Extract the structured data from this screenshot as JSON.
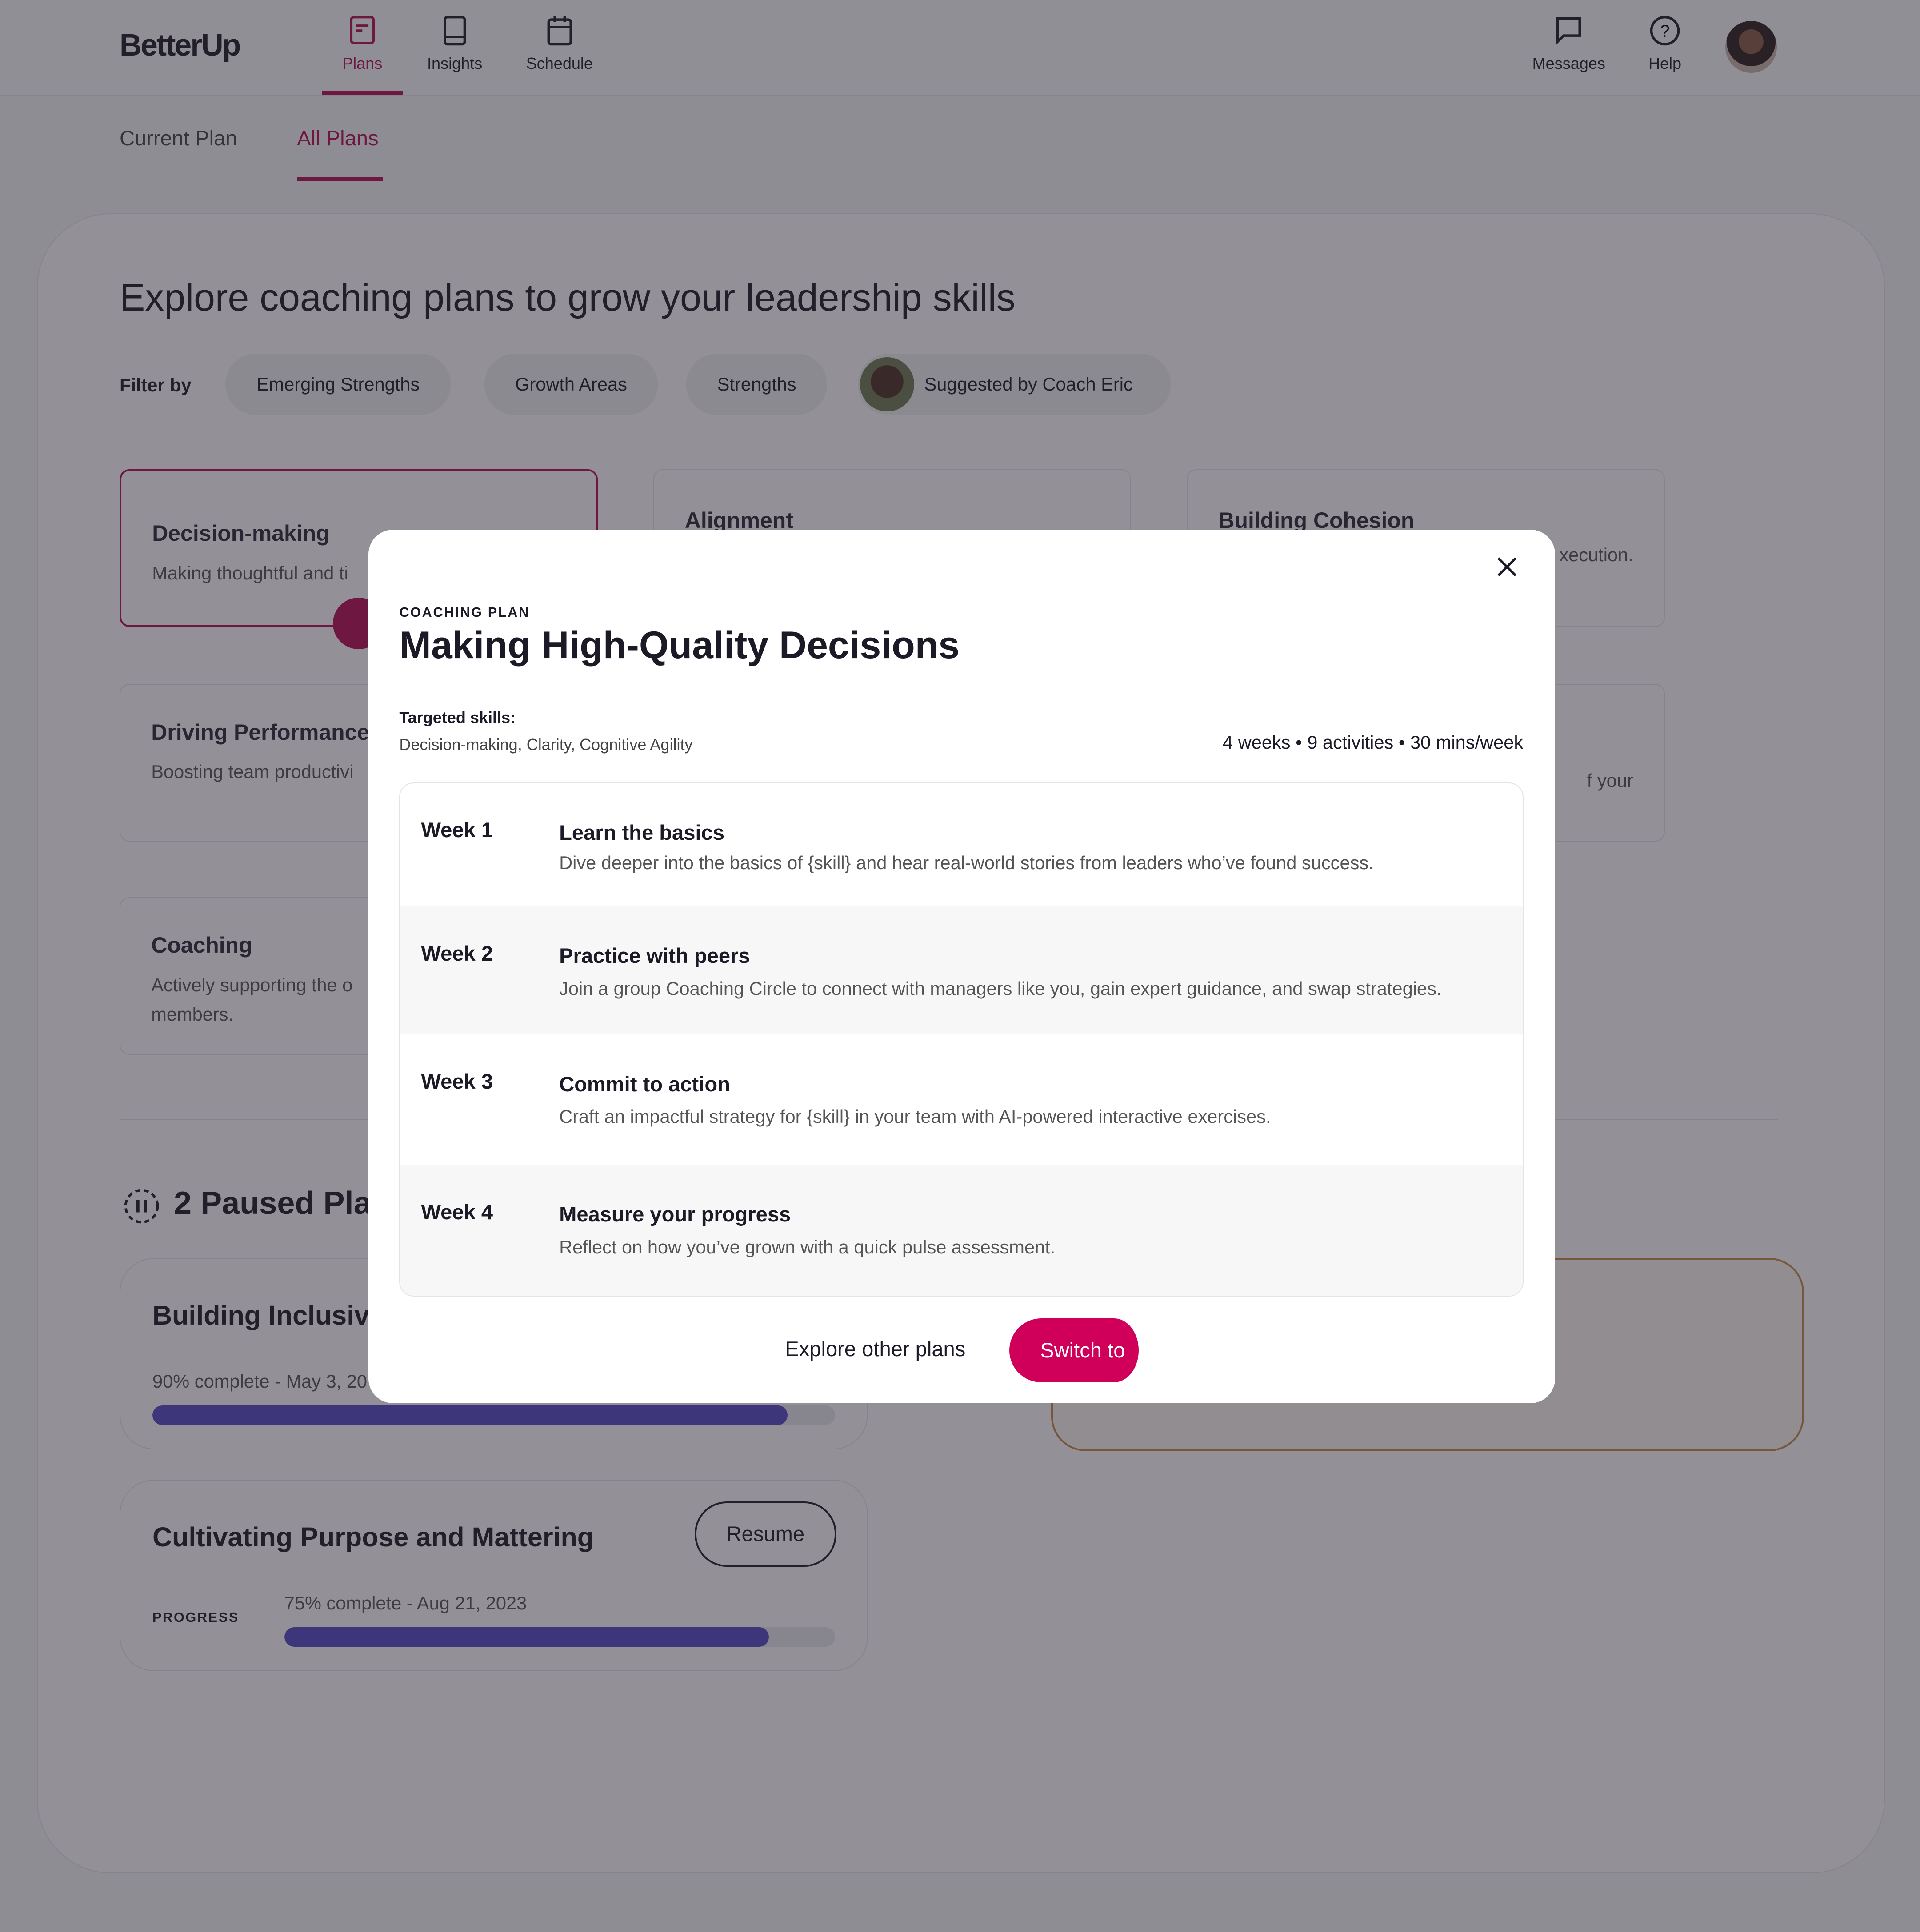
{
  "brand": "BetterUp",
  "nav": {
    "items": [
      {
        "label": "Plans",
        "icon": "plans-icon",
        "active": true
      },
      {
        "label": "Insights",
        "icon": "book-icon"
      },
      {
        "label": "Schedule",
        "icon": "calendar-icon"
      }
    ],
    "right": [
      {
        "label": "Messages",
        "icon": "message-icon"
      },
      {
        "label": "Help",
        "icon": "help-icon"
      }
    ]
  },
  "subtabs": [
    "Current Plan",
    "All Plans"
  ],
  "active_subtab": "All Plans",
  "accent": "#b50c52",
  "page": {
    "title": "Explore coaching plans to grow your leadership skills",
    "filter_label": "Filter by",
    "filters": [
      "Emerging Strengths",
      "Growth Areas",
      "Strengths",
      "Suggested by Coach Eric"
    ]
  },
  "cards": [
    {
      "title": "Decision-making",
      "desc": "Making thoughtful and ti"
    },
    {
      "title": "Alignment",
      "desc": ""
    },
    {
      "title": "Building Cohesion",
      "desc": "xecution."
    },
    {
      "title": "Driving Performance",
      "desc": "Boosting team productivi"
    },
    {
      "title": "",
      "desc": "f your"
    },
    {
      "title": "Coaching",
      "desc": "Actively supporting the o members."
    }
  ],
  "paused": {
    "title": "2 Paused Pla",
    "plans": [
      {
        "title": "Building Inclusive",
        "progress_text": "90% complete - May 3, 20",
        "progress": 90
      },
      {
        "title": "Cultivating Purpose and Mattering",
        "progress_label": "PROGRESS",
        "progress_text": "75% complete - Aug 21, 2023",
        "progress": 75,
        "button": "Resume"
      }
    ]
  },
  "modal": {
    "eyebrow": "COACHING PLAN",
    "title": "Making High-Quality Decisions",
    "skills_label": "Targeted skills:",
    "skills": "Decision-making, Clarity, Cognitive Agility",
    "meta": "4 weeks • 9 activities • 30 mins/week",
    "weeks": [
      {
        "week": "Week 1",
        "title": "Learn the basics",
        "desc": "Dive deeper into the basics of {skill} and hear real-world stories from leaders who’ve found success."
      },
      {
        "week": "Week 2",
        "title": "Practice with peers",
        "desc": "Join a group Coaching Circle to connect with managers like you, gain expert guidance, and swap strategies."
      },
      {
        "week": "Week 3",
        "title": "Commit to action",
        "desc": "Craft an impactful strategy for {skill} in your team with AI-powered interactive exercises."
      },
      {
        "week": "Week 4",
        "title": "Measure your progress",
        "desc": "Reflect on how you’ve grown with a quick pulse assessment."
      }
    ],
    "secondary": "Explore other plans",
    "primary": "Switch to",
    "primary_color": "#d0005a"
  }
}
